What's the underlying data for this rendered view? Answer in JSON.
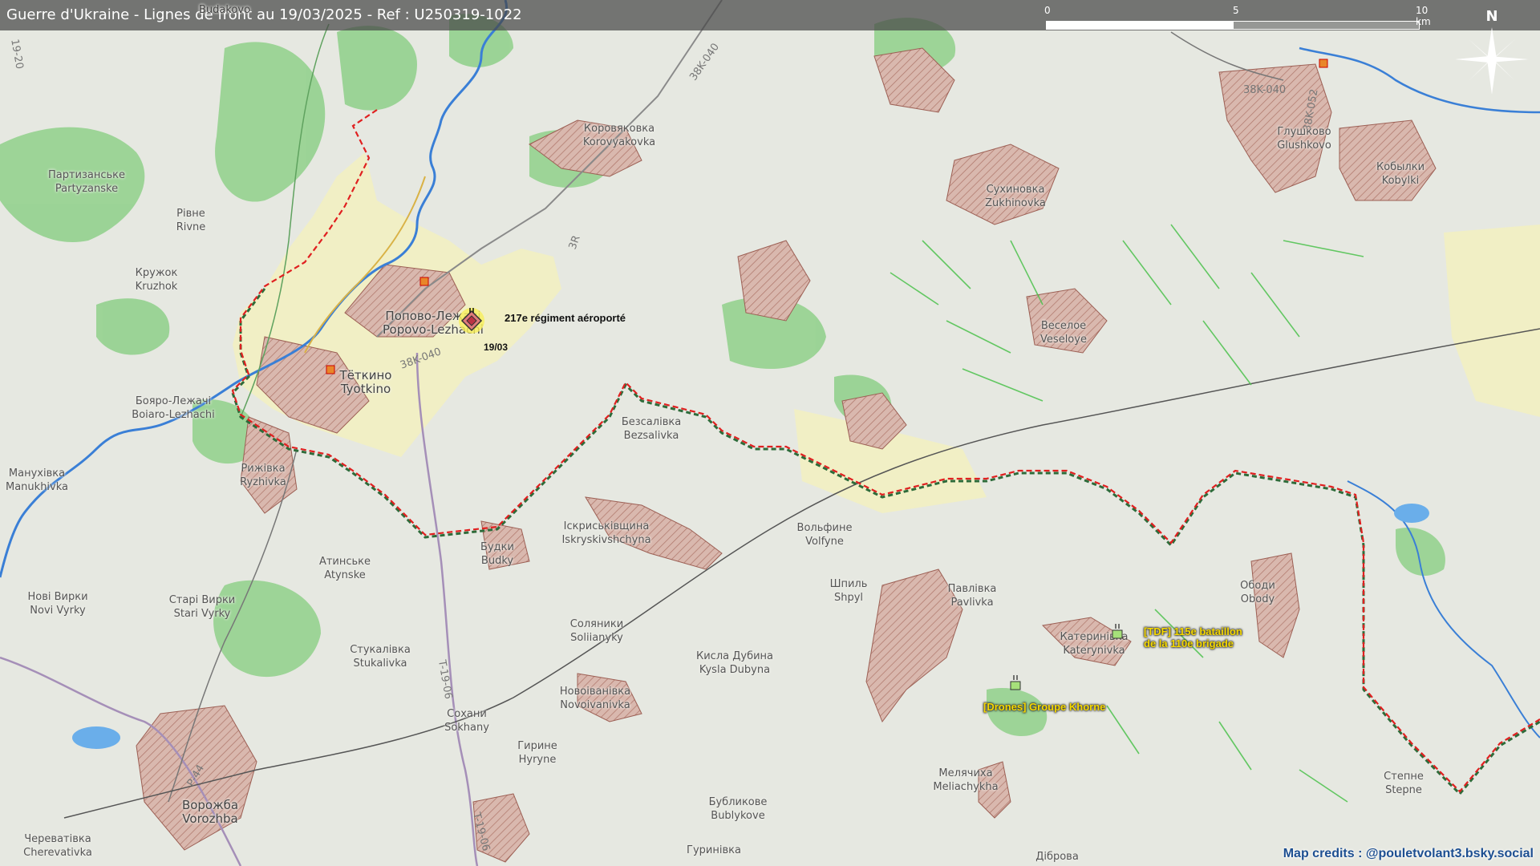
{
  "header": {
    "title": "Guerre d'Ukraine - Lignes de front au 19/03/2025 - Ref : U250319-1022"
  },
  "scale_bar": {
    "labels": [
      "0",
      "5",
      "10 km"
    ]
  },
  "compass": {
    "label": "N"
  },
  "places": [
    {
      "id": "korovyakovka",
      "cyr": "Коровяковка",
      "lat": "Korovyakovka"
    },
    {
      "id": "partyzanske",
      "cyr": "Партизанське",
      "lat": "Partyzanske"
    },
    {
      "id": "rivne",
      "cyr": "Рівне",
      "lat": "Rivne"
    },
    {
      "id": "kruzhok",
      "cyr": "Кружок",
      "lat": "Kruzhok"
    },
    {
      "id": "popovo",
      "cyr": "Попово-Лежачі",
      "lat": "Popovo-Lezhachi"
    },
    {
      "id": "tetkino",
      "cyr": "Тёткино",
      "lat": "Tyotkino"
    },
    {
      "id": "boiaro",
      "cyr": "Бояро-Лежачі",
      "lat": "Boiaro-Lezhachi"
    },
    {
      "id": "manukhivka",
      "cyr": "Манухівка",
      "lat": "Manukhivka"
    },
    {
      "id": "ryzhivka",
      "cyr": "Рижівка",
      "lat": "Ryzhivka"
    },
    {
      "id": "bezsalivka",
      "cyr": "Безсалівка",
      "lat": "Bezsalivka"
    },
    {
      "id": "iskryskivshchyna",
      "cyr": "Іскриськівщина",
      "lat": "Iskryskivshchyna"
    },
    {
      "id": "budky",
      "cyr": "Будки",
      "lat": "Budky"
    },
    {
      "id": "atynske",
      "cyr": "Атинське",
      "lat": "Atynske"
    },
    {
      "id": "novivyrky",
      "cyr": "Нові Вирки",
      "lat": "Novi Vyrky"
    },
    {
      "id": "starivyrky",
      "cyr": "Старі Вирки",
      "lat": "Stari Vyrky"
    },
    {
      "id": "stukalivka",
      "cyr": "Стукалівка",
      "lat": "Stukalivka"
    },
    {
      "id": "soliianyky",
      "cyr": "Соляники",
      "lat": "Soliianyky"
    },
    {
      "id": "novoivanivka",
      "cyr": "Новоіванівка",
      "lat": "Novoivanivka"
    },
    {
      "id": "sokhany",
      "cyr": "Сохани",
      "lat": "Sokhany"
    },
    {
      "id": "hyryne",
      "cyr": "Гирине",
      "lat": "Hyryne"
    },
    {
      "id": "vorozhba",
      "cyr": "Ворожба",
      "lat": "Vorozhba"
    },
    {
      "id": "cherevativka",
      "cyr": "Череватівка",
      "lat": "Cherevativka"
    },
    {
      "id": "volfyne",
      "cyr": "Вольфине",
      "lat": "Volfyne"
    },
    {
      "id": "shpyl",
      "cyr": "Шпиль",
      "lat": "Shpyl"
    },
    {
      "id": "kyslaDubyna",
      "cyr": "Кисла Дубина",
      "lat": "Kysla Dubyna"
    },
    {
      "id": "bublykove",
      "cyr": "Бубликове",
      "lat": "Bublykove"
    },
    {
      "id": "hurynivka",
      "cyr": "Гуринівка",
      "lat": ""
    },
    {
      "id": "pavlivka",
      "cyr": "Павлівка",
      "lat": "Pavlivka"
    },
    {
      "id": "katerynivka",
      "cyr": "Катеринівка",
      "lat": "Katerynivka"
    },
    {
      "id": "obody",
      "cyr": "Ободи",
      "lat": "Obody"
    },
    {
      "id": "meliachykha",
      "cyr": "Мелячиха",
      "lat": "Meliachykha"
    },
    {
      "id": "dibrova",
      "cyr": "Діброва",
      "lat": ""
    },
    {
      "id": "stepne",
      "cyr": "Степне",
      "lat": "Stepne"
    },
    {
      "id": "sukhinovka",
      "cyr": "Сухиновка",
      "lat": "Zukhinovka"
    },
    {
      "id": "veseloe",
      "cyr": "Веселое",
      "lat": "Veseloye"
    },
    {
      "id": "glushkovo",
      "cyr": "Глушково",
      "lat": "Glushkovo"
    },
    {
      "id": "kobylki",
      "cyr": "Кобылки",
      "lat": "Kobylki"
    },
    {
      "id": "buzhkovo",
      "cyr": "",
      "lat": "Budakovo"
    }
  ],
  "roads": {
    "r1": "38K-040",
    "r2": "38K-040",
    "r3": "3R",
    "r4": "38K-040",
    "r5": "38K-052",
    "r6": "T-19-06",
    "r7": "P-44",
    "r8": "T-19-06",
    "r9": "19-20"
  },
  "units": {
    "u217": "217e régiment aéroporté",
    "u217_date": "19/03",
    "tdf_line1": "[TDF] 115e bataillon",
    "tdf_line2": "de la 110e brigade",
    "drones": "[Drones] Groupe Khorne"
  },
  "credits": "Map credits : @pouletvolant3.bsky.social",
  "colors": {
    "front_red": "#e02020",
    "front_green": "#2e6b3a",
    "settlement_fill": "#d9b8ae",
    "settlement_hatch": "#b0786c",
    "river": "#3a7fd6",
    "forest": "#8fd08a",
    "field_green": "#4cc24c",
    "ukr_controlled_russia": "#f2f0c2"
  }
}
